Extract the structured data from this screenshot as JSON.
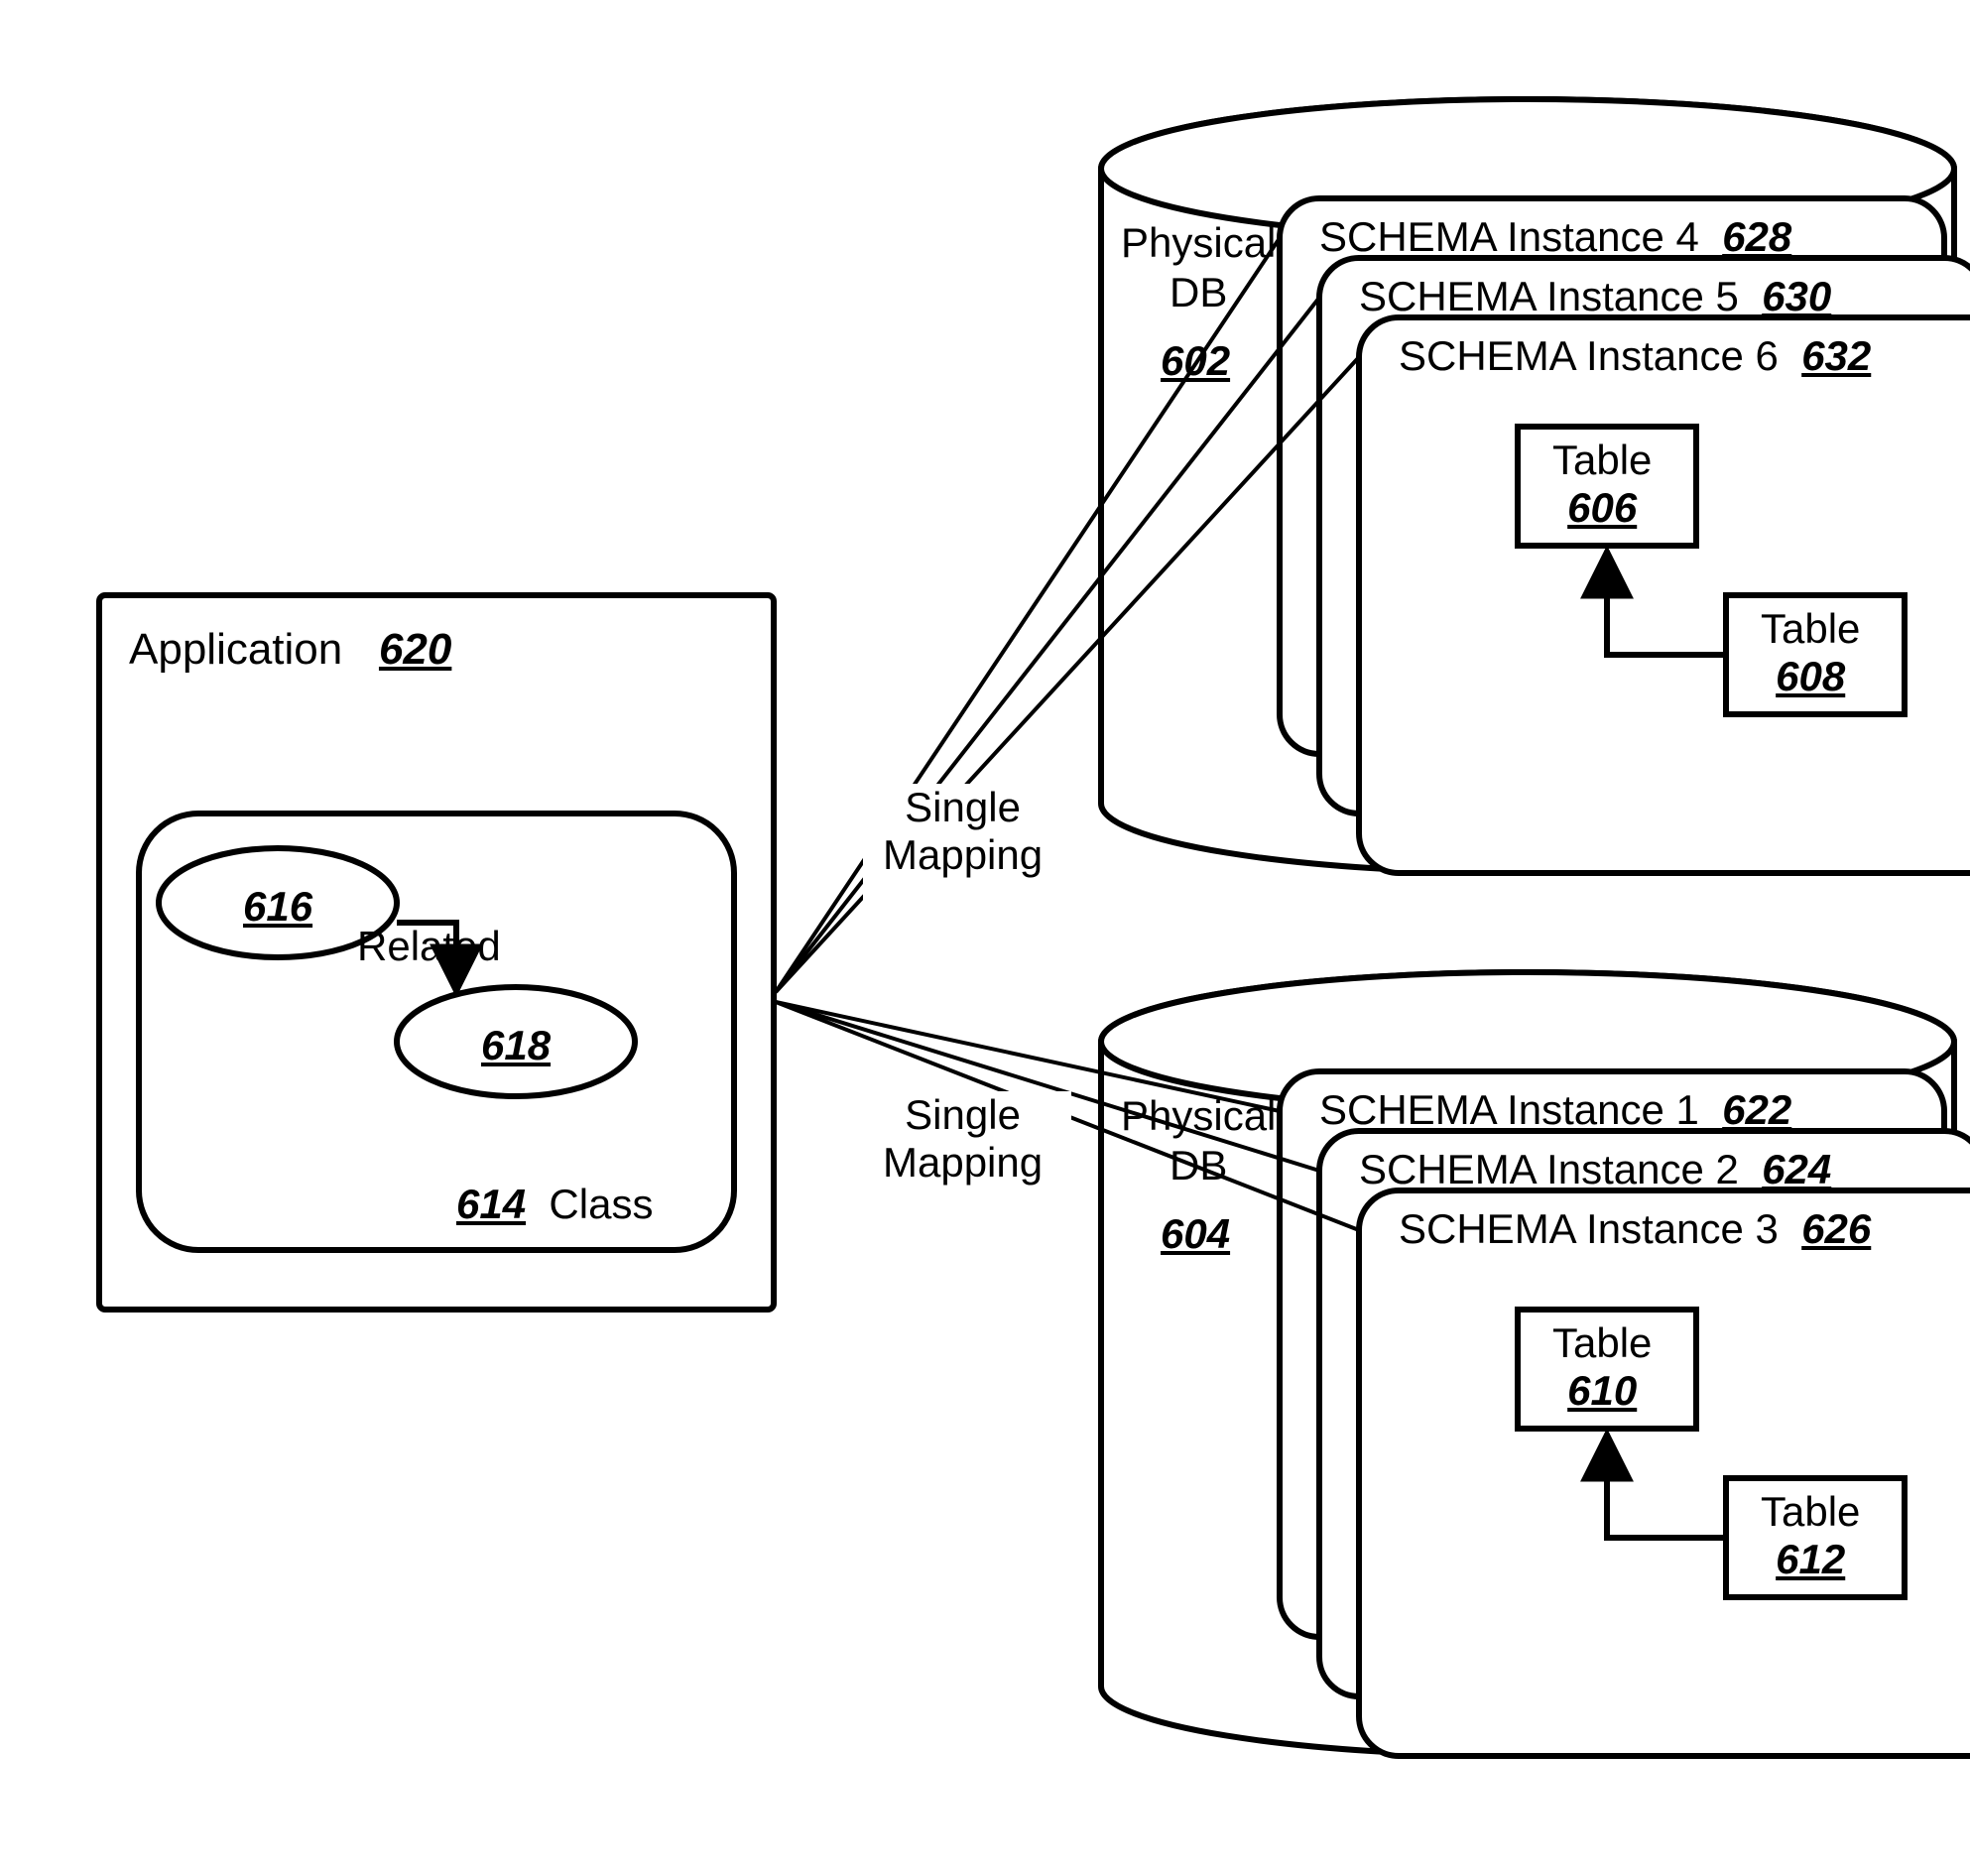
{
  "application": {
    "label": "Application",
    "ref": "620",
    "class_box": {
      "label": "Class",
      "ref": "614"
    },
    "node_a": {
      "ref": "616"
    },
    "node_b": {
      "ref": "618"
    },
    "relation": "Related"
  },
  "mapping_top": "Single\nMapping",
  "mapping_bottom": "Single\nMapping",
  "db_top": {
    "label": "Physical\nDB",
    "ref": "602",
    "schemas": [
      {
        "label": "SCHEMA Instance 4",
        "ref": "628"
      },
      {
        "label": "SCHEMA Instance 5",
        "ref": "630"
      },
      {
        "label": "SCHEMA Instance 6",
        "ref": "632"
      }
    ],
    "table_a": {
      "label": "Table",
      "ref": "606"
    },
    "table_b": {
      "label": "Table",
      "ref": "608"
    }
  },
  "db_bottom": {
    "label": "Physical\nDB",
    "ref": "604",
    "schemas": [
      {
        "label": "SCHEMA Instance 1",
        "ref": "622"
      },
      {
        "label": "SCHEMA Instance 2",
        "ref": "624"
      },
      {
        "label": "SCHEMA Instance 3",
        "ref": "626"
      }
    ],
    "table_a": {
      "label": "Table",
      "ref": "610"
    },
    "table_b": {
      "label": "Table",
      "ref": "612"
    }
  }
}
